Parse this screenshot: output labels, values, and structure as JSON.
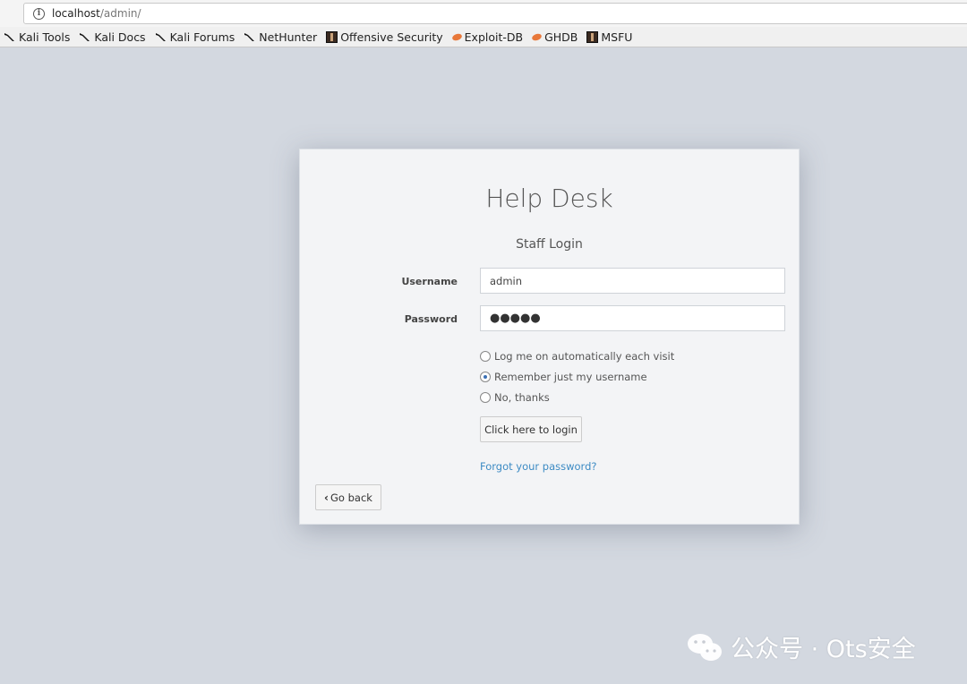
{
  "browser": {
    "url_host": "localhost",
    "url_path": "/admin/"
  },
  "bookmarks": [
    {
      "label": "Kali Tools",
      "icon": "kali-dragon-icon"
    },
    {
      "label": "Kali Docs",
      "icon": "kali-dragon-icon"
    },
    {
      "label": "Kali Forums",
      "icon": "kali-dragon-icon"
    },
    {
      "label": "NetHunter",
      "icon": "kali-dragon-icon"
    },
    {
      "label": "Offensive Security",
      "icon": "offsec-icon"
    },
    {
      "label": "Exploit-DB",
      "icon": "exploit-db-icon"
    },
    {
      "label": "GHDB",
      "icon": "exploit-db-icon"
    },
    {
      "label": "MSFU",
      "icon": "offsec-icon"
    }
  ],
  "login": {
    "title": "Help Desk",
    "subtitle": "Staff Login",
    "username_label": "Username",
    "username_value": "admin",
    "password_label": "Password",
    "password_value": "●●●●●",
    "options": [
      {
        "label": "Log me on automatically each visit",
        "checked": false
      },
      {
        "label": "Remember just my username",
        "checked": true
      },
      {
        "label": "No, thanks",
        "checked": false
      }
    ],
    "login_button": "Click here to login",
    "forgot_link": "Forgot your password?",
    "back_button": "Go back"
  },
  "watermark": {
    "text": "公众号 · Ots安全"
  }
}
